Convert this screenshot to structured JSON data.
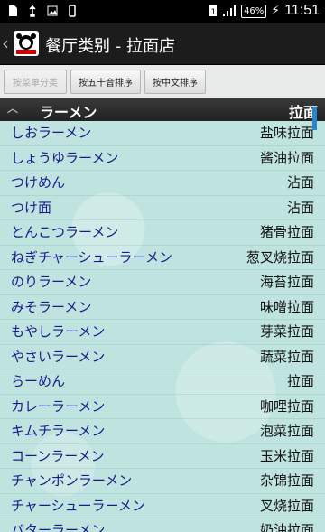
{
  "status_bar": {
    "battery": "46%",
    "time": "11:51"
  },
  "action_bar": {
    "back_glyph": "‹",
    "title": "餐厅类别 - 拉面店",
    "logo_icon": "panda-logo-icon"
  },
  "toolbar": {
    "buttons": [
      {
        "label": "按菜单分类",
        "enabled": false
      },
      {
        "label": "按五十音排序",
        "enabled": true
      },
      {
        "label": "按中文排序",
        "enabled": true
      }
    ]
  },
  "section": {
    "left": "ラーメン",
    "right": "拉面"
  },
  "items": [
    {
      "jp": "しおラーメン",
      "cn": "盐味拉面"
    },
    {
      "jp": "しょうゆラーメン",
      "cn": "酱油拉面"
    },
    {
      "jp": "つけめん",
      "cn": "沾面"
    },
    {
      "jp": "つけ面",
      "cn": "沾面"
    },
    {
      "jp": "とんこつラーメン",
      "cn": "猪骨拉面"
    },
    {
      "jp": "ねぎチャーシューラーメン",
      "cn": "葱叉烧拉面"
    },
    {
      "jp": "のりラーメン",
      "cn": "海苔拉面"
    },
    {
      "jp": "みそラーメン",
      "cn": "味噌拉面"
    },
    {
      "jp": "もやしラーメン",
      "cn": "芽菜拉面"
    },
    {
      "jp": "やさいラーメン",
      "cn": "蔬菜拉面"
    },
    {
      "jp": "らーめん",
      "cn": "拉面"
    },
    {
      "jp": "カレーラーメン",
      "cn": "咖哩拉面"
    },
    {
      "jp": "キムチラーメン",
      "cn": "泡菜拉面"
    },
    {
      "jp": "コーンラーメン",
      "cn": "玉米拉面"
    },
    {
      "jp": "チャンポンラーメン",
      "cn": "杂锦拉面"
    },
    {
      "jp": "チャーシューラーメン",
      "cn": "叉烧拉面"
    },
    {
      "jp": "バターラーメン",
      "cn": "奶油拉面"
    }
  ],
  "colors": {
    "list_background": "#bfe4e0",
    "japanese_text": "#1a1a8c",
    "chinese_text": "#111111",
    "scroll_indicator": "#2a86c8"
  }
}
